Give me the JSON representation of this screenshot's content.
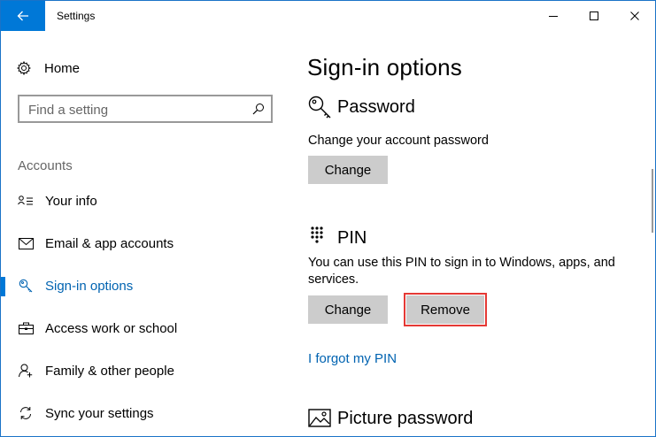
{
  "window": {
    "title": "Settings"
  },
  "sidebar": {
    "home_label": "Home",
    "search": {
      "placeholder": "Find a setting"
    },
    "section_label": "Accounts",
    "items": [
      {
        "label": "Your info",
        "icon": "person-list-icon",
        "active": false
      },
      {
        "label": "Email & app accounts",
        "icon": "mail-icon",
        "active": false
      },
      {
        "label": "Sign-in options",
        "icon": "key-icon",
        "active": true
      },
      {
        "label": "Access work or school",
        "icon": "briefcase-icon",
        "active": false
      },
      {
        "label": "Family & other people",
        "icon": "person-add-icon",
        "active": false
      },
      {
        "label": "Sync your settings",
        "icon": "sync-icon",
        "active": false
      }
    ]
  },
  "main": {
    "title": "Sign-in options",
    "password": {
      "heading": "Password",
      "description": "Change your account password",
      "change_label": "Change"
    },
    "pin": {
      "heading": "PIN",
      "description": "You can use this PIN to sign in to Windows, apps, and services.",
      "change_label": "Change",
      "remove_label": "Remove",
      "forgot_link": "I forgot my PIN"
    },
    "picture_password": {
      "heading": "Picture password"
    }
  },
  "colors": {
    "accent": "#0078d7",
    "link": "#0063b1",
    "button_bg": "#cccccc",
    "highlight_outline": "#e53935"
  }
}
